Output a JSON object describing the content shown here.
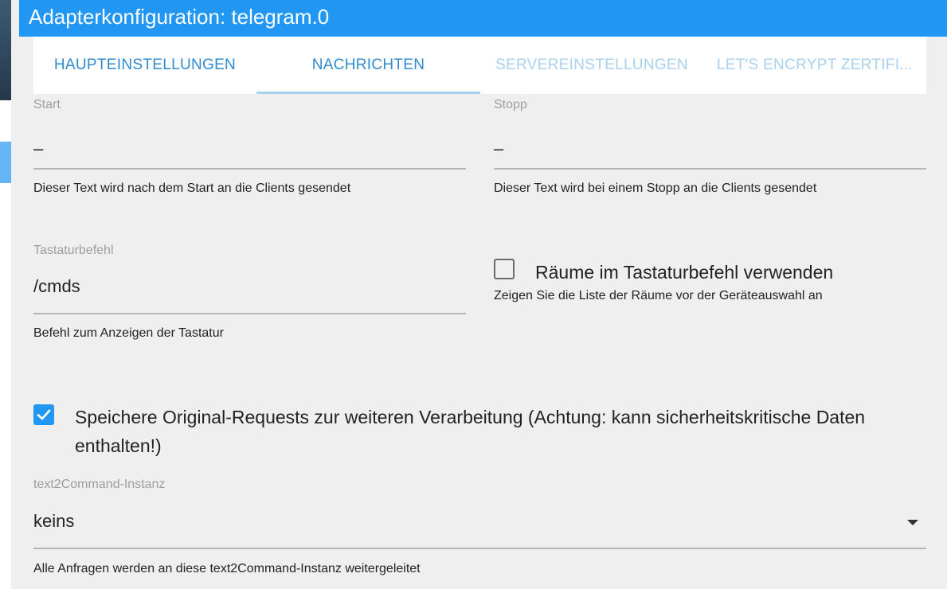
{
  "dialog": {
    "title": "Adapterkonfiguration: telegram.0"
  },
  "tabs": [
    {
      "label": "HAUPTEINSTELLUNGEN",
      "state": "enabled"
    },
    {
      "label": "NACHRICHTEN",
      "state": "selected"
    },
    {
      "label": "SERVEREINSTELLUNGEN",
      "state": "disabled"
    },
    {
      "label": "LET'S ENCRYPT ZERTIFI...",
      "state": "disabled"
    }
  ],
  "form": {
    "start": {
      "label": "Start",
      "value": "–",
      "helper": "Dieser Text wird nach dem Start an die Clients gesendet"
    },
    "stop": {
      "label": "Stopp",
      "value": "–",
      "helper": "Dieser Text wird bei einem Stopp an die Clients gesendet"
    },
    "keyboard": {
      "label": "Tastaturbefehl",
      "value": "/cmds",
      "helper": "Befehl zum Anzeigen der Tastatur"
    },
    "rooms": {
      "label": "Räume im Tastaturbefehl verwenden",
      "helper": "Zeigen Sie die Liste der Räume vor der Geräteauswahl an",
      "checked": false
    },
    "save_requests": {
      "label_line1": "Speichere Original-Requests zur weiteren Verarbeitung (Achtung: kann sicherheitskritische Daten",
      "label_line2": "enthalten!)",
      "checked": true
    },
    "text2command": {
      "label": "text2Command-Instanz",
      "value": "keins",
      "helper": "Alle Anfragen werden an diese text2Command-Instanz weitergeleitet"
    }
  },
  "colors": {
    "title_bar": "#2196f3",
    "tab_active": "#2f8ad0",
    "tab_disabled": "#a8d1ef",
    "background": "#efefef"
  }
}
